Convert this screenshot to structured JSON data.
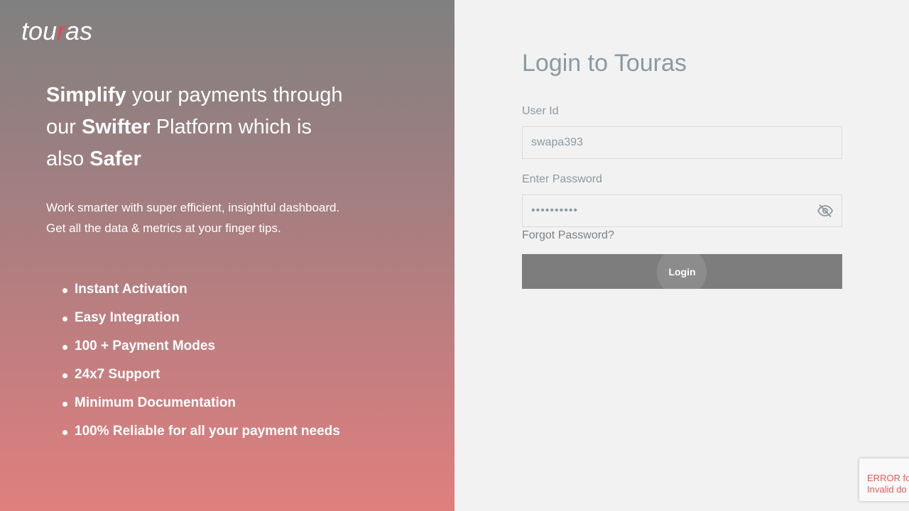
{
  "brand": {
    "logo_prefix": "tou",
    "logo_accent": "r",
    "logo_suffix": "as",
    "accent_color": "#e5484d"
  },
  "hero": {
    "line1_bold": "Simplify",
    "line1_rest": " your payments through",
    "line2_pre": "our ",
    "line2_bold": "Swifter",
    "line2_rest": " Platform which is",
    "line3_pre": "also ",
    "line3_bold": "Safer",
    "subtext_line1": "Work smarter with super efficient, insightful dashboard.",
    "subtext_line2": "Get all the data & metrics at your finger tips."
  },
  "features": [
    "Instant Activation",
    "Easy Integration",
    "100 + Payment Modes",
    "24x7 Support",
    "Minimum Documentation",
    "100% Reliable for all your payment needs"
  ],
  "login": {
    "title": "Login to Touras",
    "user_label": "User Id",
    "user_value": "swapa393",
    "password_label": "Enter Password",
    "password_value": "••••••••••",
    "password_toggle_icon": "eye-slash-icon",
    "forgot_label": "Forgot Password?",
    "submit_label": "Login"
  },
  "captcha": {
    "line1": "ERROR for",
    "line2": "Invalid do"
  }
}
